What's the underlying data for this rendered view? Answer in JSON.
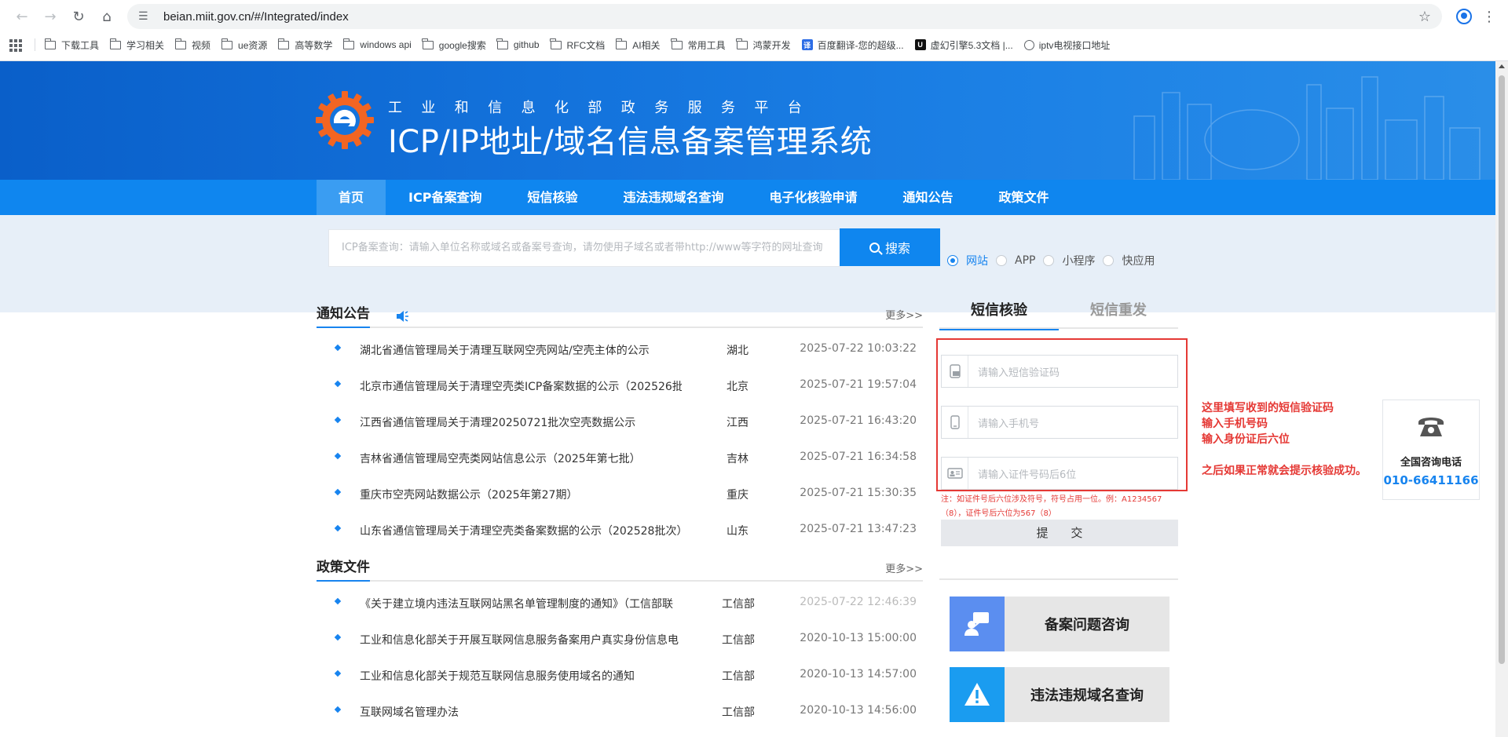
{
  "browser": {
    "url": "beian.miit.gov.cn/#/Integrated/index",
    "bookmarks": [
      {
        "label": "下载工具",
        "type": "folder"
      },
      {
        "label": "学习相关",
        "type": "folder"
      },
      {
        "label": "视频",
        "type": "folder"
      },
      {
        "label": "ue资源",
        "type": "folder"
      },
      {
        "label": "高等数学",
        "type": "folder"
      },
      {
        "label": "windows api",
        "type": "folder"
      },
      {
        "label": "google搜索",
        "type": "folder"
      },
      {
        "label": "github",
        "type": "folder"
      },
      {
        "label": "RFC文档",
        "type": "folder"
      },
      {
        "label": "AI相关",
        "type": "folder"
      },
      {
        "label": "常用工具",
        "type": "folder"
      },
      {
        "label": "鸿蒙开发",
        "type": "folder"
      },
      {
        "label": "百度翻译-您的超级...",
        "type": "site"
      },
      {
        "label": "虚幻引擎5.3文档 |...",
        "type": "site"
      },
      {
        "label": "iptv电视接口地址",
        "type": "site"
      }
    ]
  },
  "header": {
    "subtitle": "工业和信息化部政务服务平台",
    "title": "ICP/IP地址/域名信息备案管理系统"
  },
  "nav": {
    "items": [
      "首页",
      "ICP备案查询",
      "短信核验",
      "违法违规域名查询",
      "电子化核验申请",
      "通知公告",
      "政策文件"
    ]
  },
  "search": {
    "placeholder": "ICP备案查询：请输入单位名称或域名或备案号查询，请勿使用子域名或者带http://www等字符的网址查询",
    "button": "搜索",
    "options": [
      "网站",
      "APP",
      "小程序",
      "快应用"
    ],
    "selected": "网站"
  },
  "notices": {
    "title": "通知公告",
    "more": "更多>>",
    "rows": [
      {
        "title": "湖北省通信管理局关于清理互联网空壳网站/空壳主体的公示",
        "province": "湖北",
        "time": "2025-07-22 10:03:22"
      },
      {
        "title": "北京市通信管理局关于清理空壳类ICP备案数据的公示（202526批",
        "province": "北京",
        "time": "2025-07-21 19:57:04"
      },
      {
        "title": "江西省通信管理局关于清理20250721批次空壳数据公示",
        "province": "江西",
        "time": "2025-07-21 16:43:20"
      },
      {
        "title": "吉林省通信管理局空壳类网站信息公示（2025年第七批）",
        "province": "吉林",
        "time": "2025-07-21 16:34:58"
      },
      {
        "title": "重庆市空壳网站数据公示（2025年第27期）",
        "province": "重庆",
        "time": "2025-07-21 15:30:35"
      },
      {
        "title": "山东省通信管理局关于清理空壳类备案数据的公示（202528批次）",
        "province": "山东",
        "time": "2025-07-21 13:47:23"
      }
    ]
  },
  "policies": {
    "title": "政策文件",
    "more": "更多>>",
    "rows": [
      {
        "title": "《关于建立境内违法互联网站黑名单管理制度的通知》（工信部联",
        "province": "工信部",
        "time": "2025-07-22 12:46:39"
      },
      {
        "title": "工业和信息化部关于开展互联网信息服务备案用户真实身份信息电",
        "province": "工信部",
        "time": "2020-10-13 15:00:00"
      },
      {
        "title": "工业和信息化部关于规范互联网信息服务使用域名的通知",
        "province": "工信部",
        "time": "2020-10-13 14:57:00"
      },
      {
        "title": "互联网域名管理办法",
        "province": "工信部",
        "time": "2020-10-13 14:56:00"
      }
    ]
  },
  "sms": {
    "tab_verify": "短信核验",
    "tab_resend": "短信重发",
    "code_placeholder": "请输入短信验证码",
    "phone_placeholder": "请输入手机号",
    "id_placeholder": "请输入证件号码后6位",
    "note": "注：如证件号后六位涉及符号，符号占用一位。例：A1234567（8），证件号后六位为567（8）",
    "submit": "提 交"
  },
  "quick": {
    "consult": "备案问题咨询",
    "illegal": "违法违规域名查询"
  },
  "annotation": {
    "line1": "这里填写收到的短信验证码",
    "line2": "输入手机号码",
    "line3": "输入身份证后六位",
    "line4": "之后如果正常就会提示核验成功。"
  },
  "hotline": {
    "label": "全国咨询电话",
    "number": "010-66411166"
  },
  "colors": {
    "primary": "#1784ef",
    "nav": "#0f86ef",
    "annotation": "#e53935"
  }
}
